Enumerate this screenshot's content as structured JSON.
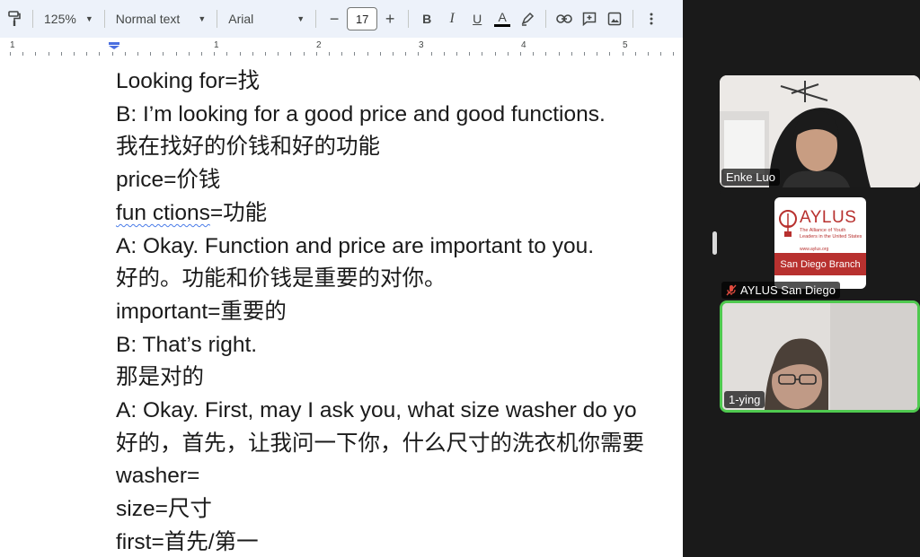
{
  "toolbar": {
    "zoom": "125%",
    "style": "Normal text",
    "font": "Arial",
    "font_size": "17",
    "minus": "−",
    "plus": "+",
    "bold": "B",
    "italic": "I",
    "underline": "U",
    "text_color": "A"
  },
  "ruler": {
    "numbers": [
      "1",
      "1",
      "2",
      "3",
      "4",
      "5"
    ]
  },
  "document": {
    "lines": [
      "Looking for=找",
      "B: I’m looking for a good price and good functions.",
      "我在找好的价钱和好的功能",
      "price=价钱",
      "fun ctions=功能",
      "A: Okay. Function and price are important to you.",
      "好的。功能和价钱是重要的对你。",
      "important=重要的",
      "B: That’s right.",
      "那是对的",
      "A: Okay. First, may I ask you, what size washer do yo",
      "好的，首先，让我问一下你，什么尺寸的洗衣机你需要",
      "washer=",
      "size=尺寸",
      "first=首先/第一"
    ],
    "squiggle_word": "fun ctions"
  },
  "zoom": {
    "participants": [
      {
        "name": "Enke Luo",
        "muted": false,
        "speaking": false
      },
      {
        "name": "AYLUS San Diego",
        "muted": true,
        "speaking": false
      },
      {
        "name": "1-ying",
        "muted": false,
        "speaking": true
      }
    ],
    "aylus_logo": {
      "title": "AYLUS",
      "subtitle": "The Alliance of Youth Leaders in the United States",
      "url": "www.aylus.org",
      "branch": "San Diego Branch"
    },
    "colors": {
      "active_speaker": "#4fc94f",
      "brand_red": "#b8312f"
    }
  }
}
